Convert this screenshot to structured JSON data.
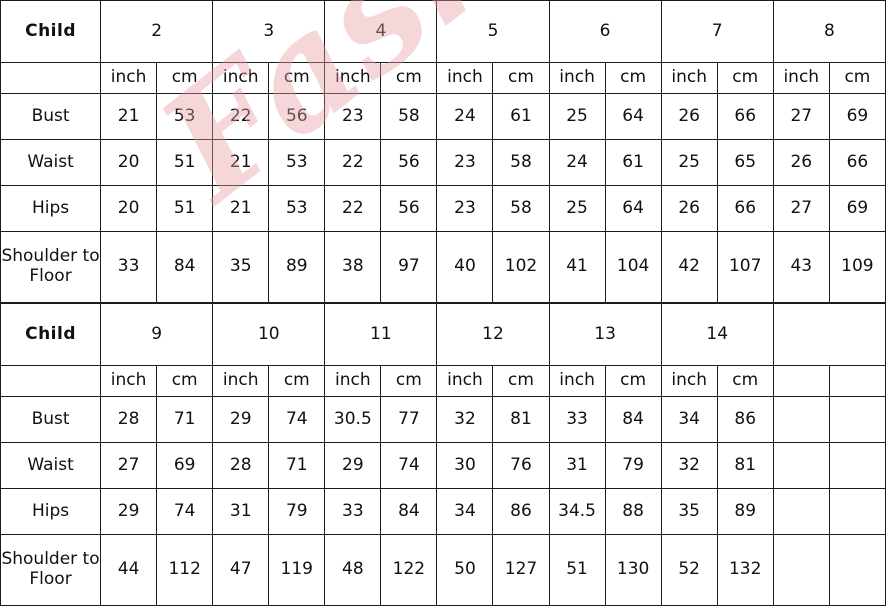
{
  "watermark": {
    "text": "Fashion"
  },
  "units": {
    "inch": "inch",
    "cm": "cm"
  },
  "tables": [
    {
      "brand_label": "Child",
      "sizes": [
        "2",
        "3",
        "4",
        "5",
        "6",
        "7",
        "8"
      ],
      "empty_size_groups": 0,
      "rows": [
        {
          "label": "Bust",
          "inch": [
            "21",
            "22",
            "23",
            "24",
            "25",
            "26",
            "27"
          ],
          "cm": [
            "53",
            "56",
            "58",
            "61",
            "64",
            "66",
            "69"
          ]
        },
        {
          "label": "Waist",
          "inch": [
            "20",
            "21",
            "22",
            "23",
            "24",
            "25",
            "26"
          ],
          "cm": [
            "51",
            "53",
            "56",
            "58",
            "61",
            "65",
            "66"
          ]
        },
        {
          "label": "Hips",
          "inch": [
            "20",
            "21",
            "22",
            "23",
            "25",
            "26",
            "27"
          ],
          "cm": [
            "51",
            "53",
            "56",
            "58",
            "64",
            "66",
            "69"
          ]
        },
        {
          "label": "Shoulder to Floor",
          "inch": [
            "33",
            "35",
            "38",
            "40",
            "41",
            "42",
            "43"
          ],
          "cm": [
            "84",
            "89",
            "97",
            "102",
            "104",
            "107",
            "109"
          ]
        }
      ]
    },
    {
      "brand_label": "Child",
      "sizes": [
        "9",
        "10",
        "11",
        "12",
        "13",
        "14"
      ],
      "empty_size_groups": 1,
      "rows": [
        {
          "label": "Bust",
          "inch": [
            "28",
            "29",
            "30.5",
            "32",
            "33",
            "34"
          ],
          "cm": [
            "71",
            "74",
            "77",
            "81",
            "84",
            "86"
          ]
        },
        {
          "label": "Waist",
          "inch": [
            "27",
            "28",
            "29",
            "30",
            "31",
            "32"
          ],
          "cm": [
            "69",
            "71",
            "74",
            "76",
            "79",
            "81"
          ]
        },
        {
          "label": "Hips",
          "inch": [
            "29",
            "31",
            "33",
            "34",
            "34.5",
            "35"
          ],
          "cm": [
            "74",
            "79",
            "84",
            "86",
            "88",
            "89"
          ]
        },
        {
          "label": "Shoulder to Floor",
          "inch": [
            "44",
            "47",
            "48",
            "50",
            "51",
            "52"
          ],
          "cm": [
            "112",
            "119",
            "122",
            "127",
            "130",
            "132"
          ]
        }
      ]
    }
  ],
  "colors": {
    "shade": "#cccccc",
    "plain": "#ffffff",
    "border": "#1a1a1a",
    "brand_text": "#4a4a4a",
    "watermark": "#e8a0a6"
  }
}
